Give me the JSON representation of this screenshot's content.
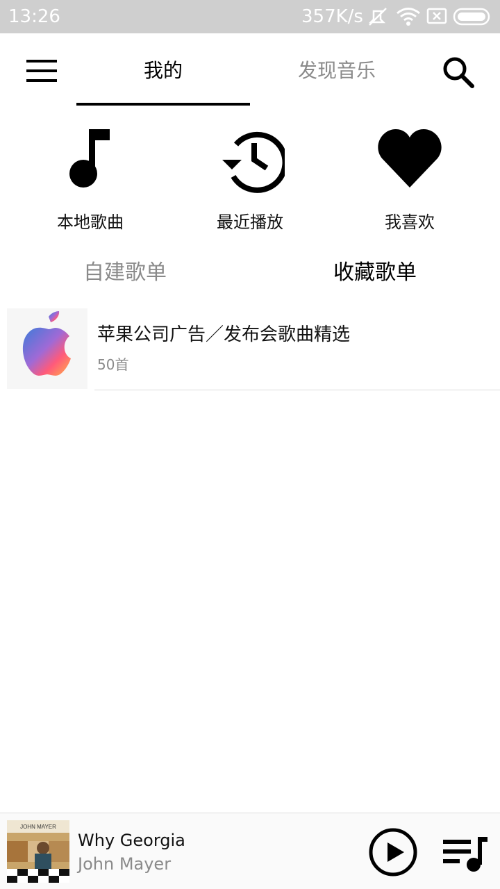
{
  "status_bar": {
    "time": "13:26",
    "network_speed": "357K/s",
    "icons": [
      "mute-icon",
      "wifi-icon",
      "sim-card-icon",
      "battery-icon"
    ]
  },
  "header": {
    "tabs": [
      {
        "label": "我的",
        "active": true
      },
      {
        "label": "发现音乐",
        "active": false
      }
    ],
    "icons": [
      "menu-icon",
      "search-icon"
    ]
  },
  "shortcuts": [
    {
      "label": "本地歌曲",
      "icon": "music-note-icon"
    },
    {
      "label": "最近播放",
      "icon": "history-icon"
    },
    {
      "label": "我喜欢",
      "icon": "heart-icon"
    }
  ],
  "playlist_tabs": [
    {
      "label": "自建歌单",
      "active": false
    },
    {
      "label": "收藏歌单",
      "active": true
    }
  ],
  "playlists": [
    {
      "title": "苹果公司广告／发布会歌曲精选",
      "count": "50首",
      "cover_icon": "apple-logo-icon"
    }
  ],
  "player": {
    "song": "Why Georgia",
    "artist": "John Mayer",
    "cover_text": "JOHN MAYER",
    "icons": [
      "play-icon",
      "queue-icon"
    ]
  },
  "colors": {
    "status_bar": "#cfcfcf",
    "active_text": "#000000",
    "inactive_text": "#8a8a8a",
    "divider": "#dcdcdc"
  }
}
